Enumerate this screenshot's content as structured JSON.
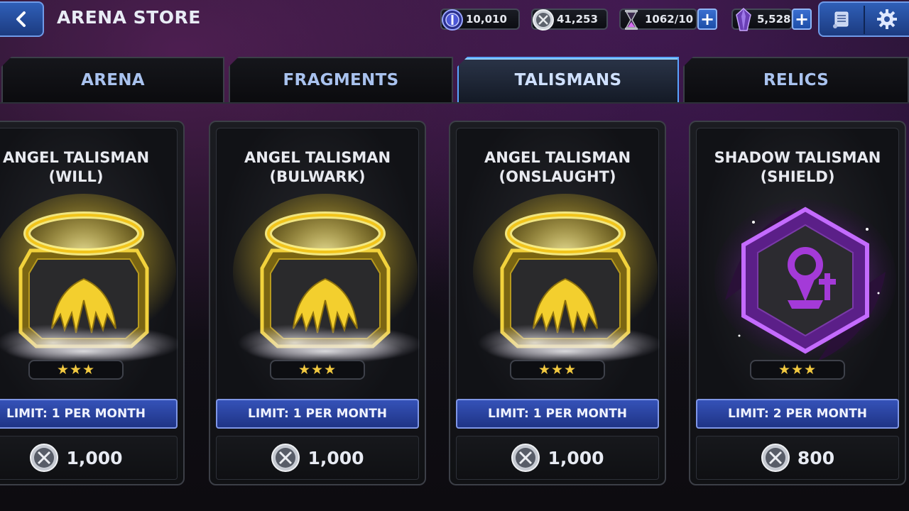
{
  "header": {
    "title": "ARENA STORE",
    "currencies": [
      {
        "name": "units-icon",
        "value": "10,010"
      },
      {
        "name": "arena-coin-icon",
        "value": "41,253"
      },
      {
        "name": "energy-icon",
        "value": "1062/10"
      },
      {
        "name": "crystal-icon",
        "value": "5,528"
      }
    ],
    "plus_label": "+"
  },
  "tabs": [
    {
      "label": "ARENA",
      "active": false
    },
    {
      "label": "FRAGMENTS",
      "active": false
    },
    {
      "label": "TALISMANS",
      "active": true
    },
    {
      "label": "RELICS",
      "active": false
    }
  ],
  "items": [
    {
      "title_line1": "ANGEL TALISMAN",
      "title_line2": "(WILL)",
      "stars": "★★★",
      "limit": "LIMIT: 1 PER MONTH",
      "price": "1,000",
      "kind": "angel"
    },
    {
      "title_line1": "ANGEL TALISMAN",
      "title_line2": "(BULWARK)",
      "stars": "★★★",
      "limit": "LIMIT: 1 PER MONTH",
      "price": "1,000",
      "kind": "angel"
    },
    {
      "title_line1": "ANGEL TALISMAN",
      "title_line2": "(ONSLAUGHT)",
      "stars": "★★★",
      "limit": "LIMIT: 1 PER MONTH",
      "price": "1,000",
      "kind": "angel"
    },
    {
      "title_line1": "SHADOW TALISMAN",
      "title_line2": "(SHIELD)",
      "stars": "★★★",
      "limit": "LIMIT: 2 PER MONTH",
      "price": "800",
      "kind": "shadow"
    }
  ],
  "colors": {
    "accent_blue": "#3552b8",
    "tab_active_border": "#59a4ff",
    "star_gold": "#f2c940",
    "angel_gold": "#f5d43a",
    "shadow_purple": "#9a3ad8"
  }
}
